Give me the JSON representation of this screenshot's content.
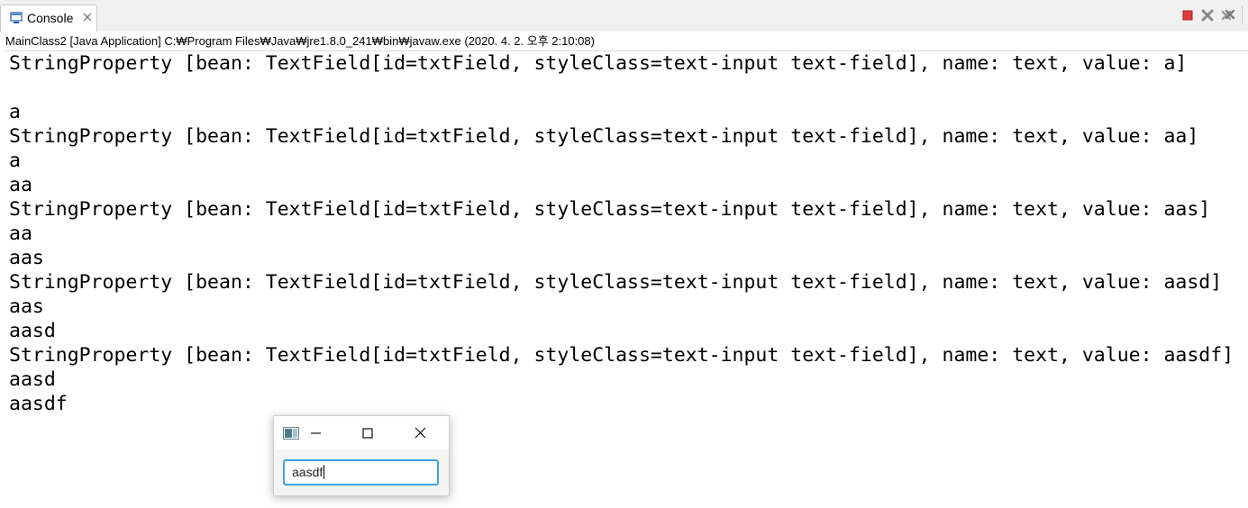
{
  "view": {
    "tab_label": "Console",
    "launch_info": "MainClass2 [Java Application] C:₩Program Files₩Java₩jre1.8.0_241₩bin₩javaw.exe (2020. 4. 2. 오후 2:10:08)"
  },
  "toolbar": {
    "icons": [
      "terminate-icon",
      "remove-launch-icon",
      "remove-all-launches-icon"
    ],
    "colors": {
      "terminate": "#e03b3b",
      "remove": "#8a8a8a"
    }
  },
  "console": {
    "lines": [
      "StringProperty [bean: TextField[id=txtField, styleClass=text-input text-field], name: text, value: a]",
      "",
      "a",
      "StringProperty [bean: TextField[id=txtField, styleClass=text-input text-field], name: text, value: aa]",
      "a",
      "aa",
      "StringProperty [bean: TextField[id=txtField, styleClass=text-input text-field], name: text, value: aas]",
      "aa",
      "aas",
      "StringProperty [bean: TextField[id=txtField, styleClass=text-input text-field], name: text, value: aasd]",
      "aas",
      "aasd",
      "StringProperty [bean: TextField[id=txtField, styleClass=text-input text-field], name: text, value: aasdf]",
      "aasd",
      "aasdf"
    ]
  },
  "fx_window": {
    "textfield_value": "aasdf",
    "icons": [
      "app-icon",
      "minimize-icon",
      "maximize-icon",
      "close-icon"
    ],
    "focus_color": "#3fa3d8"
  }
}
